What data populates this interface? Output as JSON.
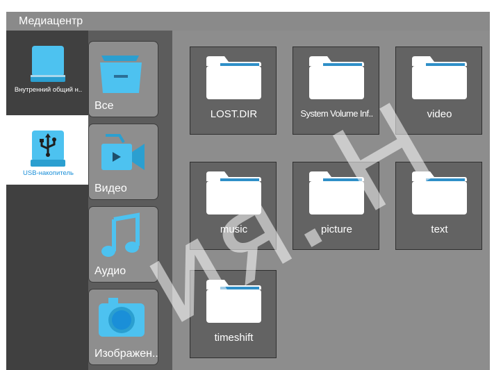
{
  "window": {
    "title": "Медиацентр"
  },
  "devices": [
    {
      "label": "Внутренний общий н..",
      "icon": "hard-drive-icon",
      "selected": false
    },
    {
      "label": "USB-накопитель",
      "icon": "usb-drive-icon",
      "selected": true
    }
  ],
  "categories": [
    {
      "label": "Все",
      "icon": "all-files-folder-icon"
    },
    {
      "label": "Видео",
      "icon": "video-camera-icon"
    },
    {
      "label": "Аудио",
      "icon": "music-note-icon"
    },
    {
      "label": "Изображен..",
      "icon": "photo-camera-icon"
    }
  ],
  "folders": [
    {
      "name": "LOST.DIR"
    },
    {
      "name": "System Volume Inf.."
    },
    {
      "name": "video"
    },
    {
      "name": "music"
    },
    {
      "name": "picture"
    },
    {
      "name": "text"
    },
    {
      "name": "timeshift"
    }
  ],
  "watermark": "ия. Н",
  "colors": {
    "accent": "#4dc2f0",
    "selected_label": "#1a8fd8",
    "panel_dark": "#404040"
  }
}
